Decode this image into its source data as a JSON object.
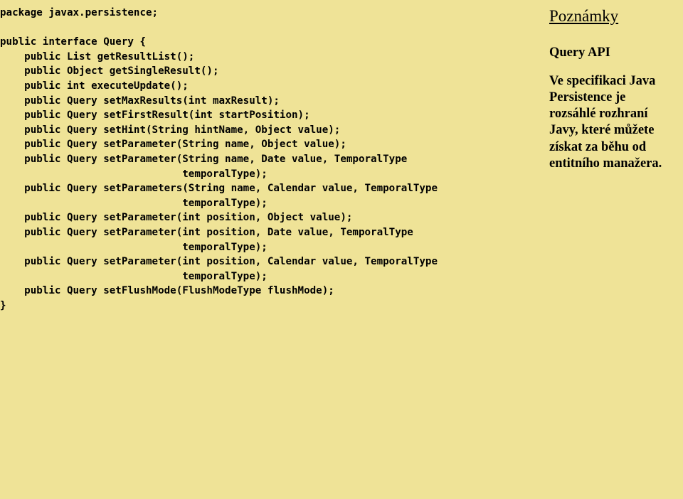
{
  "code": {
    "l01": "package javax.persistence;",
    "l02": "",
    "l03": "public interface Query {",
    "l04": "    public List getResultList();",
    "l05": "    public Object getSingleResult();",
    "l06": "    public int executeUpdate();",
    "l07": "    public Query setMaxResults(int maxResult);",
    "l08": "    public Query setFirstResult(int startPosition);",
    "l09": "    public Query setHint(String hintName, Object value);",
    "l10": "    public Query setParameter(String name, Object value);",
    "l11": "    public Query setParameter(String name, Date value, TemporalType",
    "l12": "                              temporalType);",
    "l13": "    public Query setParameters(String name, Calendar value, TemporalType",
    "l14": "                              temporalType);",
    "l15": "    public Query setParameter(int position, Object value);",
    "l16": "    public Query setParameter(int position, Date value, TemporalType",
    "l17": "                              temporalType);",
    "l18": "    public Query setParameter(int position, Calendar value, TemporalType",
    "l19": "                              temporalType);",
    "l20": "    public Query setFlushMode(FlushModeType flushMode);",
    "l21": "}"
  },
  "sidebar": {
    "title": "Poznámky",
    "heading": "Query API",
    "body": "Ve specifikaci Java Persistence je rozsáhlé rozhraní Javy, které můžete získat za běhu od entitního manažera."
  }
}
